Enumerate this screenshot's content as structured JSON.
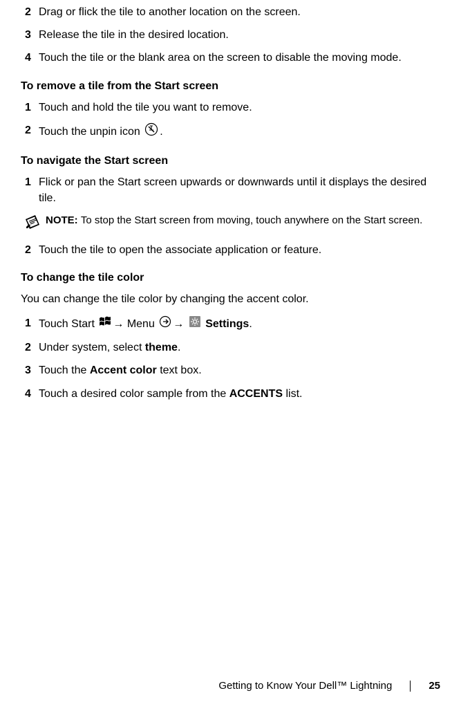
{
  "section1": {
    "step2": "Drag or flick the tile to another location on the screen.",
    "step3": "Release the tile in the desired location.",
    "step4": "Touch the tile or the blank area on the screen to disable the moving mode."
  },
  "section2": {
    "heading": "To remove a tile from the Start screen",
    "step1": "Touch and hold the tile you want to remove.",
    "step2_pre": "Touch the unpin icon ",
    "step2_post": "."
  },
  "section3": {
    "heading": "To navigate the Start screen",
    "step1": "Flick or pan the Start screen upwards or downwards until it displays the desired tile.",
    "note_label": "NOTE: ",
    "note_text": "To stop the Start screen from moving, touch anywhere on the Start screen.",
    "step2": "Touch the tile to open the associate application or feature."
  },
  "section4": {
    "heading": "To change the tile color",
    "intro": "You can change the tile color by changing the accent color.",
    "step1_pre": "Touch Start ",
    "step1_arrow1": "→ ",
    "step1_menu": "Menu ",
    "step1_arrow2": "→ ",
    "step1_settings": " Settings",
    "step1_post": ".",
    "step2_pre": "Under system, select ",
    "step2_bold": "theme",
    "step2_post": ".",
    "step3_pre": "Touch the ",
    "step3_bold": "Accent color",
    "step3_post": " text box.",
    "step4_pre": "Touch a desired color sample from the ",
    "step4_bold": "ACCENTS",
    "step4_post": " list."
  },
  "footer": {
    "chapter": "Getting to Know Your Dell™ Lightning",
    "page": "25"
  },
  "nums": {
    "n1": "1",
    "n2": "2",
    "n3": "3",
    "n4": "4"
  }
}
